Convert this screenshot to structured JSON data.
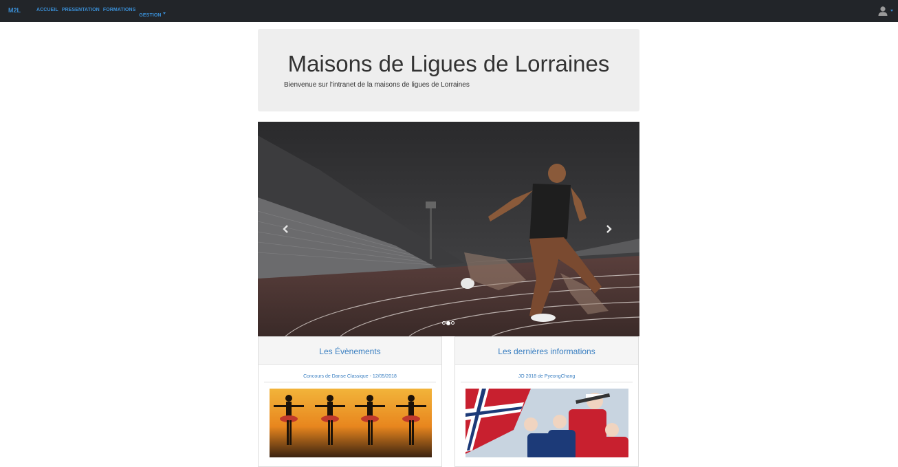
{
  "nav": {
    "brand": "M2L",
    "links": [
      "ACCUEIL",
      "PRESENTATION",
      "FORMATIONS",
      "GESTION"
    ],
    "user_icon": "user-icon",
    "accent": "#3a8fd6",
    "background": "#222529"
  },
  "jumbotron": {
    "title": "Maisons de Ligues de Lorraines",
    "subtitle": "Bienvenue sur l'intranet de la maisons de ligues de Lorraines"
  },
  "carousel": {
    "slide_count": 3,
    "active_index": 1,
    "prev_icon": "chevron-left-icon",
    "next_icon": "chevron-right-icon"
  },
  "panels": [
    {
      "heading": "Les Évènements",
      "item_title": "Concours de Danse Classique - 12/05/2018"
    },
    {
      "heading": "Les dernières informations",
      "item_title": "JO 2018 de PyeongChang"
    }
  ]
}
